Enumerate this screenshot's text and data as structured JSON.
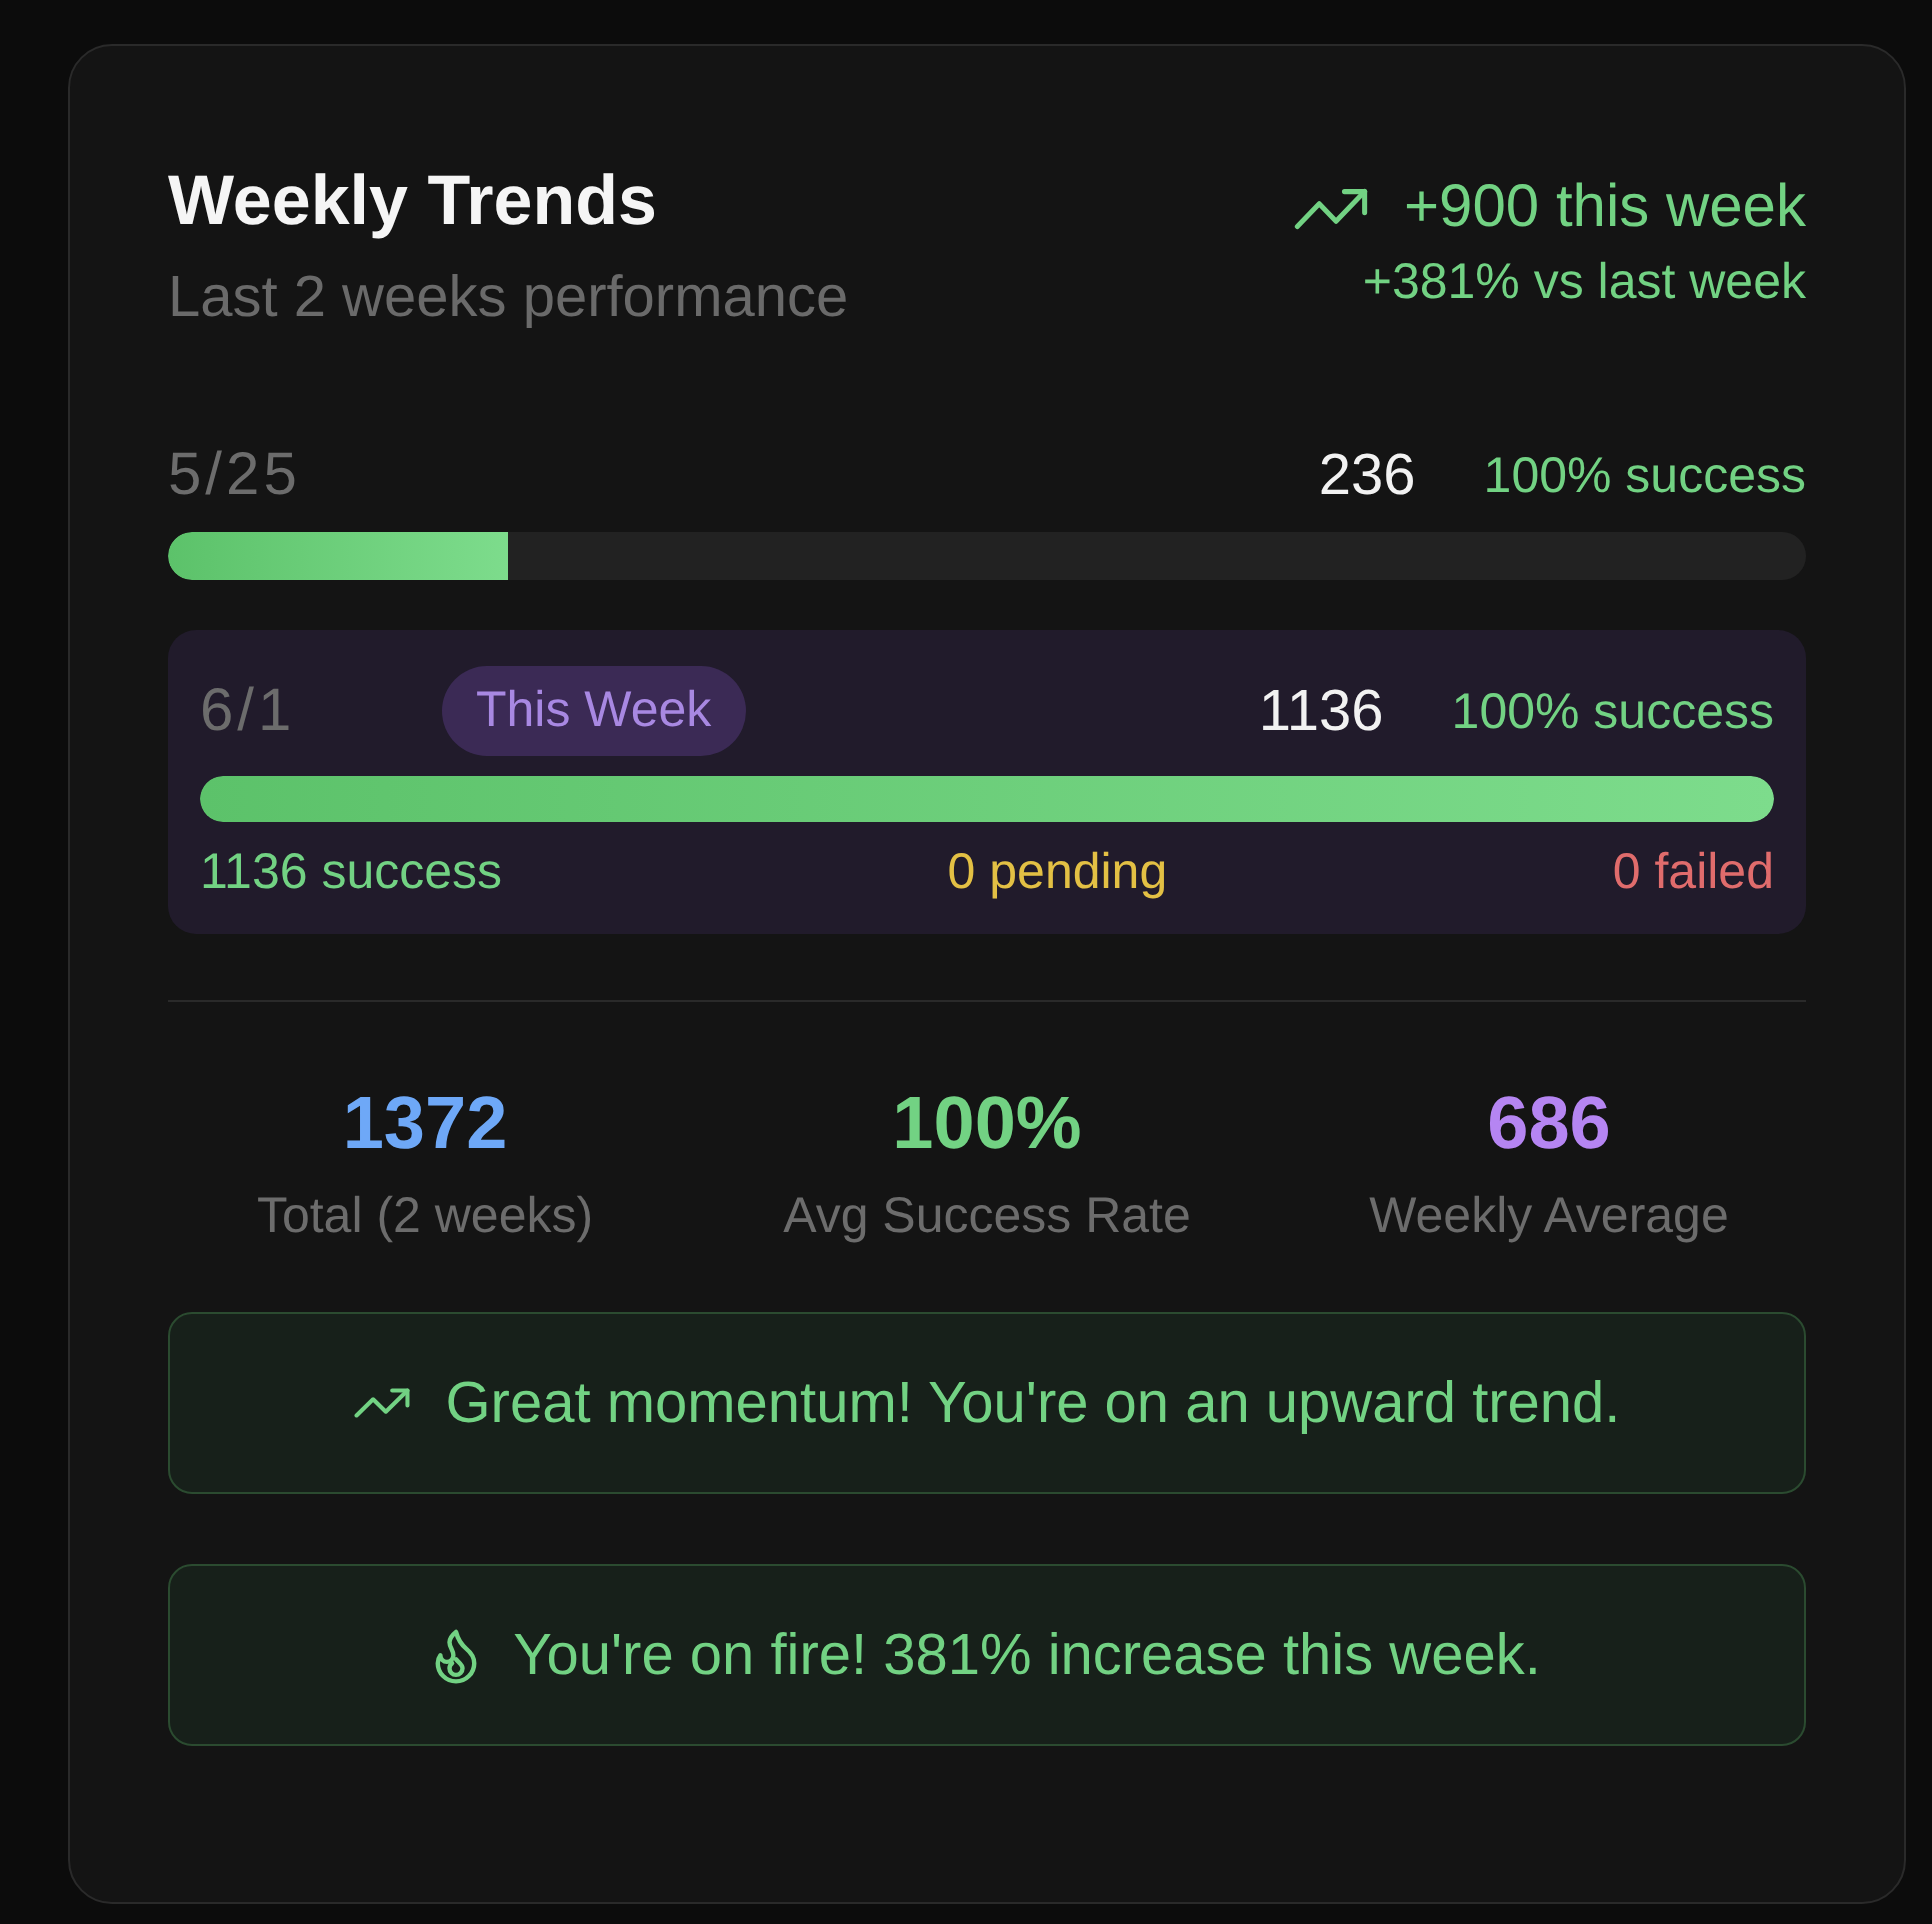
{
  "header": {
    "title": "Weekly Trends",
    "subtitle": "Last 2 weeks performance",
    "change": "+900 this week",
    "change_detail": "+381% vs last week"
  },
  "weeks": [
    {
      "date": "5/25",
      "current": false,
      "count": "236",
      "success_rate": "100% success",
      "level": 0.208
    },
    {
      "date": "6/1",
      "current": true,
      "badge": "This Week",
      "count": "1136",
      "success_rate": "100% success",
      "level": 1,
      "breakdown": [
        {
          "text": "1136 success",
          "color": "#72d283"
        },
        {
          "text": "0 pending",
          "color": "#e3c044"
        },
        {
          "text": "0 failed",
          "color": "#e06c6c"
        }
      ]
    }
  ],
  "stats": [
    {
      "value": "1372",
      "label": "Total (2 weeks)",
      "color": "#6ea8f7"
    },
    {
      "value": "100%",
      "label": "Avg Success Rate",
      "color": "#72d283"
    },
    {
      "value": "686",
      "label": "Weekly Average",
      "color": "#b585f2"
    }
  ],
  "messages": [
    {
      "kind": "trend",
      "text": "Great momentum! You're on an upward trend."
    },
    {
      "kind": "fire",
      "text": "You're on fire! 381% increase this week."
    }
  ]
}
